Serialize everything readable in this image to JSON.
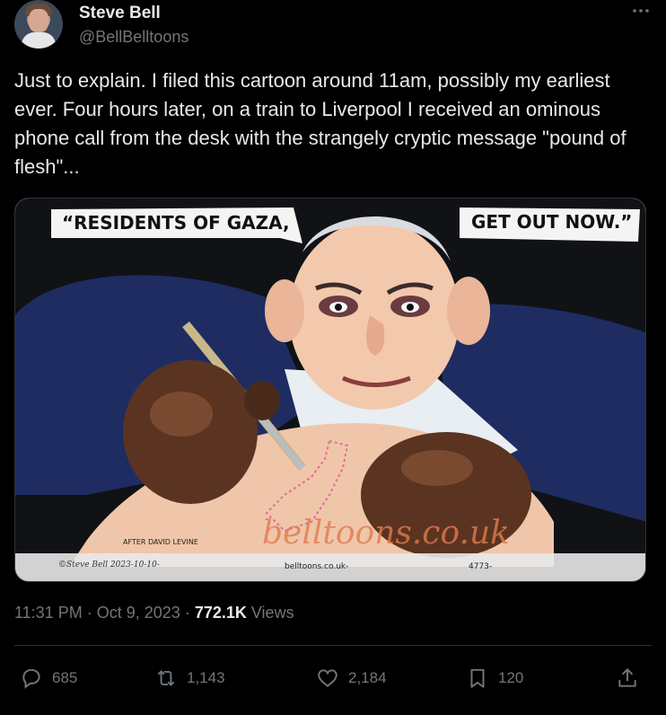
{
  "author": {
    "name": "Steve Bell",
    "handle": "@BellBelltoons"
  },
  "more_icon": "more-horizontal-icon",
  "tweet": {
    "text": "Just to explain. I filed this cartoon around 11am, possibly my earliest ever. Four hours later, on a train to Liverpool I received an ominous phone call from the desk with the strangely cryptic message \"pound of flesh\"..."
  },
  "media": {
    "caption_left": "“RESIDENTS OF GAZA,",
    "caption_right": "GET OUT NOW.”",
    "credit_after": "AFTER DAVID LEVINE",
    "credit_signature": "©Steve Bell 2023-10-10-",
    "credit_site": "belltoons.co.uk-",
    "credit_number": "4773-",
    "watermark": "belltoons.co.uk"
  },
  "meta": {
    "time": "11:31 PM",
    "date": "Oct 9, 2023",
    "views_count": "772.1K",
    "views_label": "Views"
  },
  "actions": {
    "replies": "685",
    "retweets": "1,143",
    "likes": "2,184",
    "bookmarks": "120"
  },
  "colors": {
    "background": "#000000",
    "text": "#e7e9ea",
    "muted": "#71767b",
    "divider": "#2f3336"
  }
}
